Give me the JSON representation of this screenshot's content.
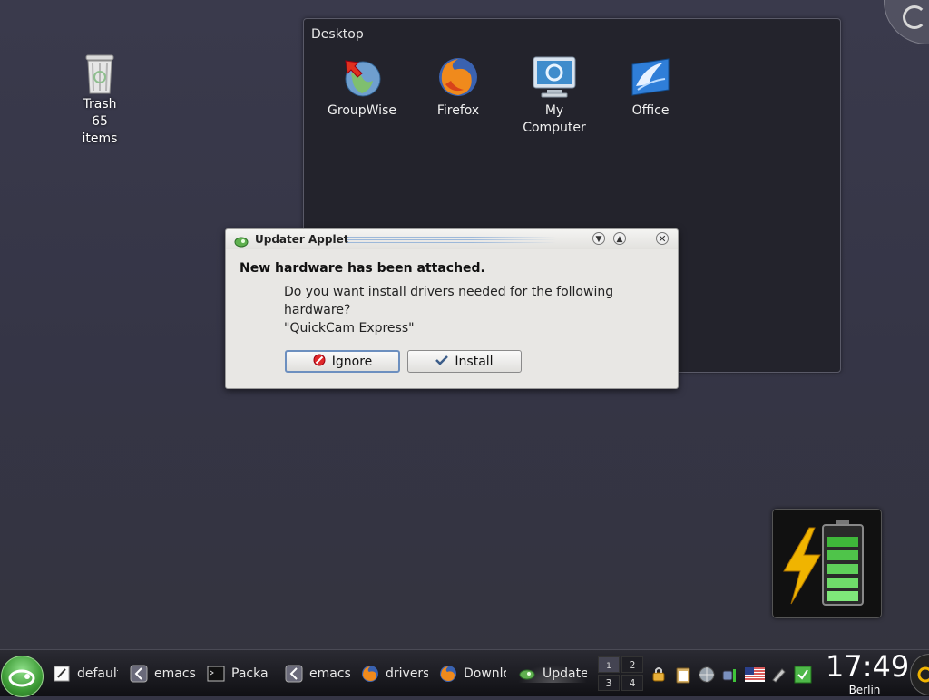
{
  "desktop": {
    "trash": {
      "label": "Trash",
      "count": "65 items"
    },
    "folder_view": {
      "title": "Desktop",
      "icons": [
        {
          "label": "GroupWise",
          "icon": "groupwise-icon"
        },
        {
          "label": "Firefox",
          "icon": "firefox-icon"
        },
        {
          "label": "My Computer",
          "icon": "my-computer-icon"
        },
        {
          "label": "Office",
          "icon": "office-icon"
        }
      ]
    }
  },
  "dialog": {
    "title": "Updater Applet",
    "heading": "New hardware has been attached.",
    "message_line1": "Do you want install drivers needed for the following hardware?",
    "message_line2": "\"QuickCam Express\"",
    "ignore_label": "Ignore",
    "install_label": "Install"
  },
  "taskbar": {
    "tasks": [
      {
        "label": "default",
        "icon": "text-editor-icon"
      },
      {
        "label": "emacs",
        "icon": "emacs-icon"
      },
      {
        "label": "Packa",
        "icon": "terminal-icon"
      },
      {
        "label": "emacs",
        "icon": "emacs-icon"
      },
      {
        "label": "drivers",
        "icon": "firefox-icon"
      },
      {
        "label": "Downlo",
        "icon": "firefox-icon"
      },
      {
        "label": "Update",
        "icon": "updater-icon"
      }
    ],
    "pager": [
      "1",
      "2",
      "3",
      "4"
    ],
    "clock": {
      "time": "17:49",
      "city": "Berlin"
    }
  },
  "colors": {
    "accent_green": "#4bb143",
    "battery_bolt": "#f0b400",
    "focus_blue": "#6c8fbf"
  }
}
